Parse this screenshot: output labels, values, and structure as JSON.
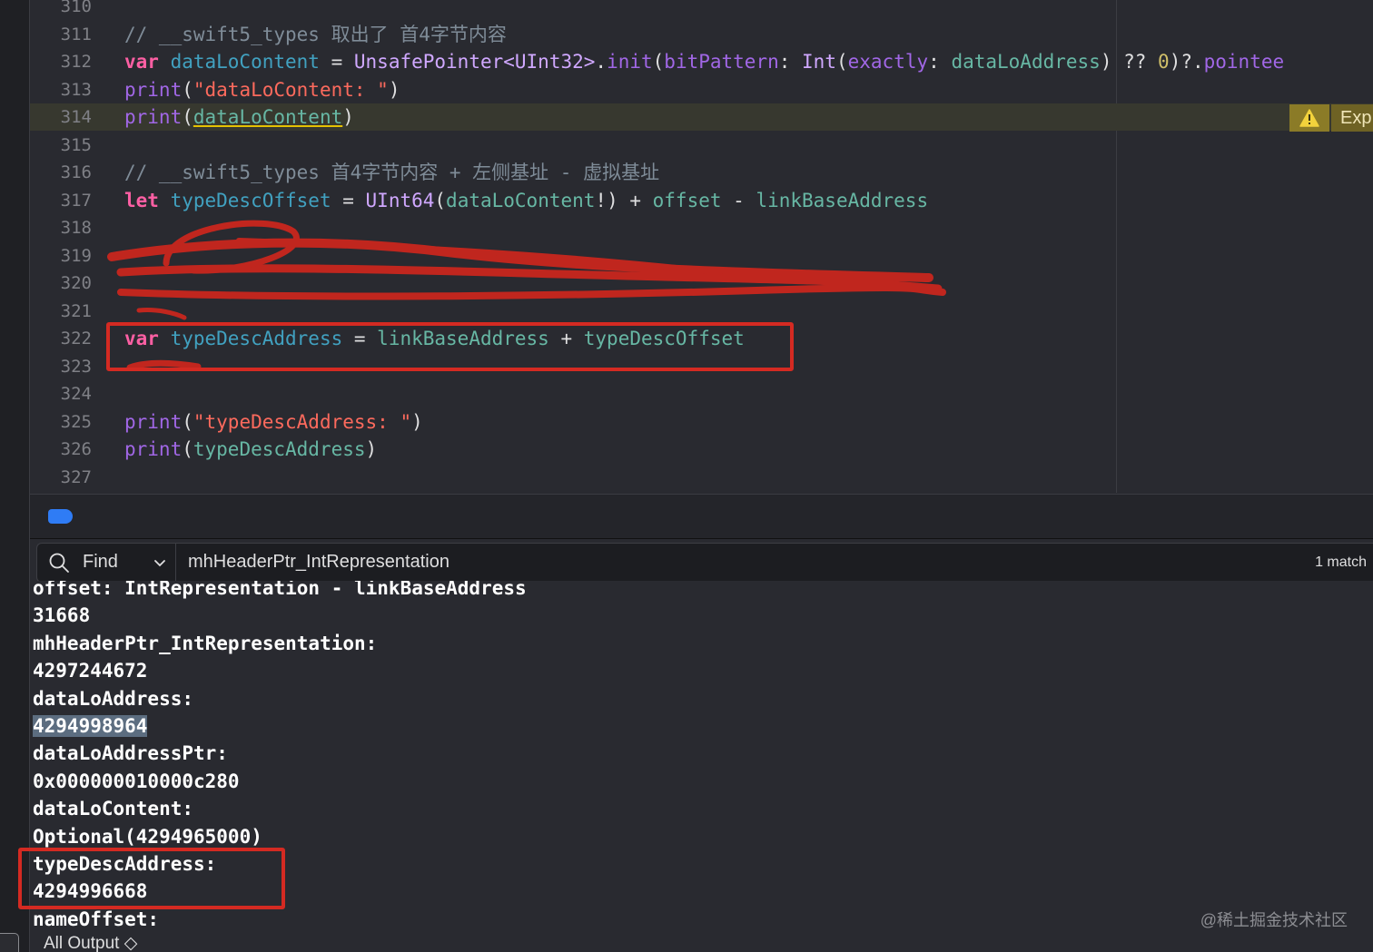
{
  "editor": {
    "lines": [
      {
        "n": "310",
        "tokens": []
      },
      {
        "n": "311",
        "tokens": [
          {
            "c": "comment",
            "t": "// __swift5_types 取出了 首4字节内容"
          }
        ]
      },
      {
        "n": "312",
        "tokens": [
          {
            "c": "kw",
            "t": "var "
          },
          {
            "c": "decl",
            "t": "dataLoContent"
          },
          {
            "c": "plain",
            "t": " = "
          },
          {
            "c": "type",
            "t": "UnsafePointer<UInt32>"
          },
          {
            "c": "plain",
            "t": "."
          },
          {
            "c": "fn",
            "t": "init"
          },
          {
            "c": "plain",
            "t": "("
          },
          {
            "c": "fn",
            "t": "bitPattern"
          },
          {
            "c": "plain",
            "t": ": "
          },
          {
            "c": "type",
            "t": "Int"
          },
          {
            "c": "plain",
            "t": "("
          },
          {
            "c": "fn",
            "t": "exactly"
          },
          {
            "c": "plain",
            "t": ": "
          },
          {
            "c": "prop",
            "t": "dataLoAddress"
          },
          {
            "c": "plain",
            "t": ") ?? "
          },
          {
            "c": "num",
            "t": "0"
          },
          {
            "c": "plain",
            "t": ")?."
          },
          {
            "c": "fn",
            "t": "pointee"
          }
        ]
      },
      {
        "n": "313",
        "tokens": [
          {
            "c": "fn",
            "t": "print"
          },
          {
            "c": "plain",
            "t": "("
          },
          {
            "c": "str",
            "t": "\"dataLoContent: \""
          },
          {
            "c": "plain",
            "t": ")"
          }
        ]
      },
      {
        "n": "314",
        "current": true,
        "tokens": [
          {
            "c": "fn",
            "t": "print"
          },
          {
            "c": "plain",
            "t": "("
          },
          {
            "c": "prop underline",
            "t": "dataLoContent"
          },
          {
            "c": "plain",
            "t": ")"
          }
        ]
      },
      {
        "n": "315",
        "tokens": []
      },
      {
        "n": "316",
        "tokens": [
          {
            "c": "comment",
            "t": "// __swift5_types 首4字节内容 + 左侧基址 - 虚拟基址"
          }
        ]
      },
      {
        "n": "317",
        "tokens": [
          {
            "c": "kw",
            "t": "let "
          },
          {
            "c": "decl",
            "t": "typeDescOffset"
          },
          {
            "c": "plain",
            "t": " = "
          },
          {
            "c": "type",
            "t": "UInt64"
          },
          {
            "c": "plain",
            "t": "("
          },
          {
            "c": "prop",
            "t": "dataLoContent"
          },
          {
            "c": "plain",
            "t": "!) + "
          },
          {
            "c": "prop",
            "t": "offset"
          },
          {
            "c": "plain",
            "t": " - "
          },
          {
            "c": "prop",
            "t": "linkBaseAddress"
          }
        ]
      },
      {
        "n": "318",
        "tokens": []
      },
      {
        "n": "319",
        "tokens": []
      },
      {
        "n": "320",
        "tokens": []
      },
      {
        "n": "321",
        "tokens": []
      },
      {
        "n": "322",
        "tokens": [
          {
            "c": "kw",
            "t": "var "
          },
          {
            "c": "decl",
            "t": "typeDescAddress"
          },
          {
            "c": "plain",
            "t": " = "
          },
          {
            "c": "prop",
            "t": "linkBaseAddress"
          },
          {
            "c": "plain",
            "t": " + "
          },
          {
            "c": "prop",
            "t": "typeDescOffset"
          }
        ]
      },
      {
        "n": "323",
        "tokens": []
      },
      {
        "n": "324",
        "tokens": []
      },
      {
        "n": "325",
        "tokens": [
          {
            "c": "fn",
            "t": "print"
          },
          {
            "c": "plain",
            "t": "("
          },
          {
            "c": "str",
            "t": "\"typeDescAddress: \""
          },
          {
            "c": "plain",
            "t": ")"
          }
        ]
      },
      {
        "n": "326",
        "tokens": [
          {
            "c": "fn",
            "t": "print"
          },
          {
            "c": "plain",
            "t": "("
          },
          {
            "c": "prop",
            "t": "typeDescAddress"
          },
          {
            "c": "plain",
            "t": ")"
          }
        ]
      },
      {
        "n": "327",
        "tokens": []
      }
    ],
    "warning_badge": {
      "icon": "warning-triangle-icon",
      "text": "Exp"
    }
  },
  "find_bar": {
    "mode": "Find",
    "query": "mhHeaderPtr_IntRepresentation",
    "match_count": "1 match"
  },
  "console": {
    "lines": [
      "offset: IntRepresentation - linkBaseAddress",
      "31668",
      "mhHeaderPtr_IntRepresentation:",
      "4297244672",
      "dataLoAddress:",
      "4294998964",
      "dataLoAddressPtr:",
      "0x000000010000c280",
      "dataLoContent:",
      "Optional(4294965000)",
      "typeDescAddress:",
      "4294996668",
      "nameOffset:"
    ],
    "selected_line": "4294998964",
    "scope": "All Output ◇"
  },
  "watermark": "@稀土掘金技术社区",
  "colors": {
    "background": "#292a30",
    "keyword": "#fc5fa3",
    "string": "#fc6a5d",
    "annotation_red": "#d42a22",
    "accent_blue": "#2f7cf5"
  }
}
